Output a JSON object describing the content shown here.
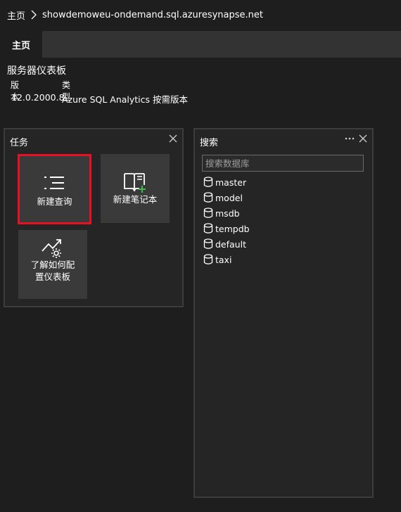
{
  "breadcrumb": {
    "home": "主页",
    "server": "showdemoweu-ondemand.sql.azuresynapse.net"
  },
  "tabs": [
    {
      "label": "主页"
    }
  ],
  "dashboard": {
    "title": "服务器仪表板",
    "version_label": "版本",
    "type_label": "类型",
    "version_value": "12.0.2000.8",
    "type_value": "Azure SQL Analytics 按需版本"
  },
  "tasks_widget": {
    "title": "任务",
    "tiles": [
      {
        "label": "新建查询",
        "icon": "new-query-icon",
        "selected": true
      },
      {
        "label": "新建笔记本",
        "icon": "new-notebook-icon"
      },
      {
        "label_line1": "了解如何配",
        "label_line2": "置仪表板",
        "icon": "configure-dashboard-icon"
      }
    ]
  },
  "search_widget": {
    "title": "搜索",
    "placeholder": "搜索数据库",
    "databases": [
      "master",
      "model",
      "msdb",
      "tempdb",
      "default",
      "taxi"
    ]
  },
  "colors": {
    "selected_border": "#e81123",
    "accent_green": "#3fb950"
  }
}
